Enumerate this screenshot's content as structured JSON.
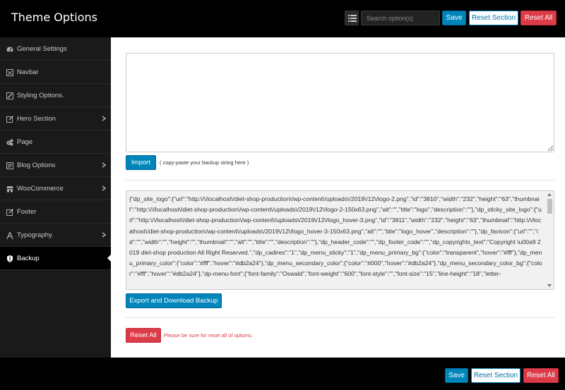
{
  "header": {
    "title": "Theme Options",
    "search_placeholder": "Search option(s)",
    "save_label": "Save",
    "reset_section_label": "Reset Section",
    "reset_all_label": "Reset All"
  },
  "sidebar": {
    "items": [
      {
        "label": "General Settings",
        "icon": "tachometer-icon",
        "has_submenu": false,
        "active": false
      },
      {
        "label": "Navbar",
        "icon": "navbar-icon",
        "has_submenu": false,
        "active": false
      },
      {
        "label": "Styling Options.",
        "icon": "brush-icon",
        "has_submenu": false,
        "active": false
      },
      {
        "label": "Hero Section",
        "icon": "edit-icon",
        "has_submenu": true,
        "active": false
      },
      {
        "label": "Page",
        "icon": "cogs-icon",
        "has_submenu": false,
        "active": false
      },
      {
        "label": "Blog Options",
        "icon": "blog-icon",
        "has_submenu": true,
        "active": false
      },
      {
        "label": "WooCommerce",
        "icon": "store-icon",
        "has_submenu": true,
        "active": false
      },
      {
        "label": "Footer",
        "icon": "edit-icon",
        "has_submenu": false,
        "active": false
      },
      {
        "label": "Typography.",
        "icon": "font-icon",
        "has_submenu": true,
        "active": false
      },
      {
        "label": "Backup",
        "icon": "shield-icon",
        "has_submenu": false,
        "active": true
      }
    ]
  },
  "main": {
    "import_value": "",
    "import_button_label": "Import",
    "import_hint": "( copy-paste your backup string here )",
    "export_text": "{\"dp_site_logo\":{\"url\":\"http:\\/\\/localhost\\/diet-shop-production\\/wp-content\\/uploads\\/2019\\/12\\/logo-2.png\",\"id\":\"3810\",\"width\":\"232\",\"height\":\"63\",\"thumbnail\":\"http:\\/\\/localhost\\/diet-shop-production\\/wp-content\\/uploads\\/2019\\/12\\/logo-2-150x63.png\",\"alt\":\"\",\"title\":\"logo\",\"description\":\"\"},\"dp_sticky_site_logo\":{\"url\":\"http:\\/\\/localhost\\/diet-shop-production\\/wp-content\\/uploads\\/2019\\/12\\/logo_hover-3.png\",\"id\":\"3811\",\"width\":\"232\",\"height\":\"63\",\"thumbnail\":\"http:\\/\\/localhost\\/diet-shop-production\\/wp-content\\/uploads\\/2019\\/12\\/logo_hover-3-150x63.png\",\"alt\":\"\",\"title\":\"logo_hover\",\"description\":\"\"},\"dp_favicon\":{\"url\":\"\",\"id\":\"\",\"width\":\"\",\"height\":\"\",\"thumbnail\":\"\",\"alt\":\"\",\"title\":\"\",\"description\":\"\"},\"dp_header_code\":\"\",\"dp_footer_code\":\"\",\"dp_copyrights_text\":\"Copyright \\u00a9 2019 diet-shop production All Right Reserved.\",\"dp_cadires\":\"1\",\"dp_menu_sticky\":\"1\",\"dp_menu_primary_bg\":{\"color\":\"transparent\",\"hover\":\"#fff\"},\"dp_menu_primary_color\":{\"color\":\"#fff\",\"hover\":\"#db2a24\"},\"dp_menu_secondary_color\":{\"color\":\"#000\",\"hover\":\"#db2a24\"},\"dp_menu_secondary_color_bg\":{\"color\":\"#fff\",\"hover\":\"#db2a24\"},\"dp-menu-font\":{\"font-family\":\"Oswald\",\"font-weight\":\"600\",\"font-style\":\"\",\"font-size\":\"15\",\"line-height\":\"18\",\"letter-",
    "export_button_label": "Export and Download Backup",
    "reset_all_label": "Reset All",
    "reset_warning": "Please be sure for reset all of options."
  },
  "footer": {
    "save_label": "Save",
    "reset_section_label": "Reset Section",
    "reset_all_label": "Reset All"
  },
  "colors": {
    "primary": "#0085ba",
    "danger": "#dc3b48",
    "sidebar_bg": "#1a1a1a",
    "header_bg": "#000000"
  }
}
